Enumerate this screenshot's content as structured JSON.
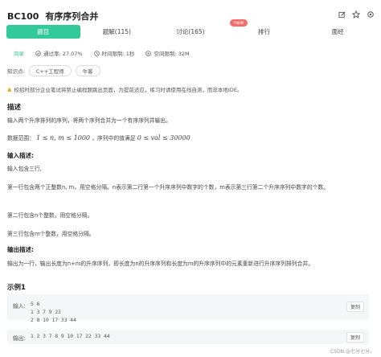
{
  "problem": {
    "id": "BC100",
    "title": "有序序列合并"
  },
  "tabs": [
    {
      "label": "题目",
      "active": true
    },
    {
      "label": "题解(115)",
      "active": false
    },
    {
      "label": "讨论(165)",
      "active": false
    },
    {
      "label": "排行",
      "active": false
    },
    {
      "label": "面经",
      "active": false
    }
  ],
  "new_badge": "new",
  "meta": {
    "level": "简单",
    "pass_rate": "通过率: 27.07%",
    "time_limit": "时间限制: 1秒",
    "space_limit": "空间限制: 32M"
  },
  "knowledge": {
    "label": "知识点:",
    "chips": [
      "C++工程师",
      "牛客"
    ]
  },
  "warning": "校招时部分企业笔试将禁止编程题跳出页面，为提前适应，练习时请使用在线自测，而非本地IDE。",
  "description": {
    "title": "描述",
    "text": "输入两个升序排列的序列，将两个序列合并为一个有序序列并输出。",
    "range_prefix": "数据范围：",
    "range_math1": "1 ≤ n, m ≤ 1000",
    "range_mid": "，序列中的值满足",
    "range_math2": "0 ≤ val ≤ 30000"
  },
  "input_desc": {
    "title": "输入描述:",
    "lines": [
      "输入包含三行,",
      "第一行包含两个正整数n, m，用空格分隔。n表示第二行第一个升序序列中数字的个数，m表示第三行第二个升序序列中数字的个数。",
      "第二行包含n个整数，用空格分隔。",
      "第三行包含m个整数，用空格分隔。"
    ]
  },
  "output_desc": {
    "title": "输出描述:",
    "text": "输出为一行，输出长度为n+m的升序序列，即长度为n的升序序列和长度为m的升序序列中的元素重新进行升序序列排列合并。"
  },
  "example": {
    "title": "示例1",
    "input_label": "输入:",
    "input_lines": [
      "5 6",
      "1 3 7 9 22",
      "2 8 10 17 33 44"
    ],
    "output_label": "输出:",
    "output_line": "1 2 3 7 8 9 10 17 22 33 44",
    "copy_label": "复制"
  },
  "footer": "CSDN @七分七分。",
  "colors": {
    "accent": "#32ca99",
    "badge": "#f56c6c",
    "warning": "#f5a623"
  }
}
